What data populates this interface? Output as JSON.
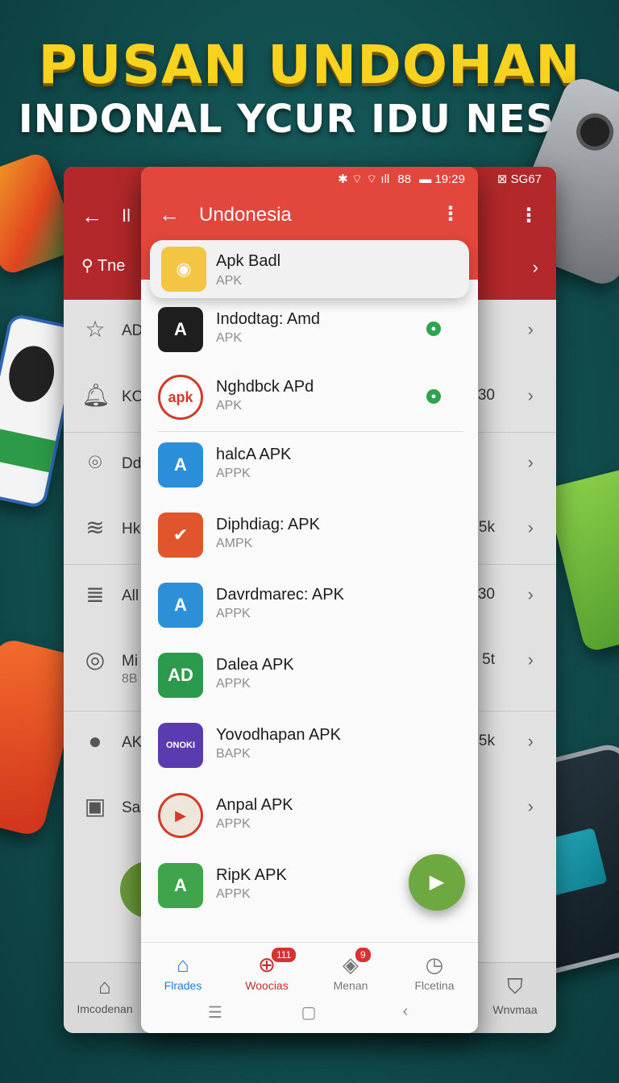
{
  "headline": {
    "line1": "PUSAN UNDOHAN",
    "line2": "INDONAL YCUR IDU NESIA"
  },
  "back_screen": {
    "status": "⊠  SG67",
    "title": "Il",
    "search_hint": "Tne",
    "rows": [
      {
        "label": "AD",
        "value": "",
        "icon": "star-icon"
      },
      {
        "label": "KO",
        "value": "30",
        "icon": "bell-icon"
      },
      {
        "label": "Dd",
        "value": "",
        "icon": "pin-icon"
      },
      {
        "label": "Hk",
        "value": "5k",
        "icon": "layers-icon"
      },
      {
        "label": "All",
        "value": "30",
        "icon": "stack-icon"
      },
      {
        "label": "Mi",
        "sub": "8B",
        "value": "5t",
        "icon": "search-circle-icon"
      },
      {
        "label": "AK",
        "value": "5k",
        "icon": "person-icon"
      },
      {
        "label": "Sa",
        "value": "",
        "icon": "folder-icon"
      }
    ],
    "nav": [
      {
        "label": "Imcodenan",
        "icon": "home-icon"
      },
      {
        "label": "Wnvmaa",
        "icon": "shield-icon"
      }
    ]
  },
  "status_bar": {
    "icons": "✱ ⌔ ⌔ ıll",
    "battery": "88",
    "time": "19:29"
  },
  "app_bar": {
    "title": "Undonesia"
  },
  "apps": [
    {
      "name": "Apk Badl",
      "sub": "APK",
      "color": "#f4c542",
      "glyph": "◉",
      "highlighted": true,
      "status": false
    },
    {
      "name": "Indodtag: Amd",
      "sub": "APK",
      "color": "#1e1e1e",
      "glyph": "A",
      "status": true
    },
    {
      "name": "Nghdbck APd",
      "sub": "APK",
      "color": "#ffffff",
      "glyph": "apk",
      "status": true
    },
    {
      "name": "halcA APK",
      "sub": "APPK",
      "color": "#2a8fd8",
      "glyph": "A",
      "status": false
    },
    {
      "name": "Diphdiag: APK",
      "sub": "AMPK",
      "color": "#e0552c",
      "glyph": "✔",
      "status": false
    },
    {
      "name": "Davrdmarec: APK",
      "sub": "APPK",
      "color": "#2c8fd8",
      "glyph": "A",
      "status": false
    },
    {
      "name": "Dalea APK",
      "sub": "APPK",
      "color": "#2b9a4d",
      "glyph": "AD",
      "status": false
    },
    {
      "name": "Yovodhapan APK",
      "sub": "BAPK",
      "color": "#5a3bb0",
      "glyph": "ONOKI",
      "status": false
    },
    {
      "name": "Anpal APK",
      "sub": "APPK",
      "color": "#efe6da",
      "glyph": "▶",
      "status": false
    },
    {
      "name": "RipK APK",
      "sub": "APPK",
      "color": "#3fa44c",
      "glyph": "A",
      "status": false
    }
  ],
  "bottom_nav": [
    {
      "label": "Flrades",
      "icon": "home-icon",
      "state": "active",
      "badge": ""
    },
    {
      "label": "Woocias",
      "icon": "globe-icon",
      "state": "alert",
      "badge": "111"
    },
    {
      "label": "Menan",
      "icon": "map-icon",
      "state": "normal",
      "badge": "9"
    },
    {
      "label": "Flcetina",
      "icon": "clock-icon",
      "state": "normal",
      "badge": ""
    }
  ],
  "system_nav": {
    "menu": "☰",
    "home": "▢",
    "back": "‹"
  },
  "colors": {
    "front_header": "#e2463c",
    "back_header": "#b3282a",
    "fab": "#6ea841",
    "active_nav": "#2a7bd6"
  }
}
